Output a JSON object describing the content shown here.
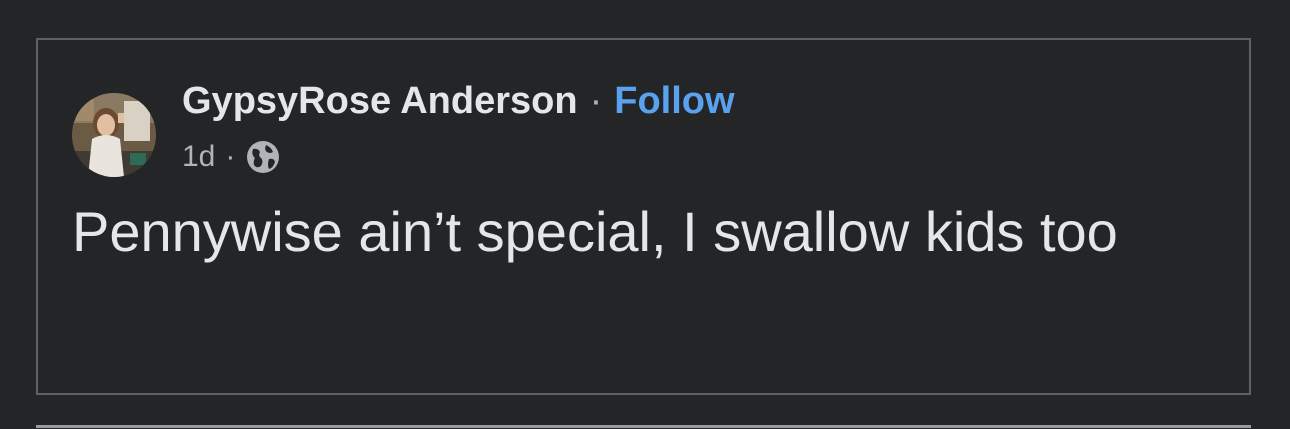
{
  "post": {
    "author_name": "GypsyRose Anderson",
    "separator": "·",
    "follow_label": "Follow",
    "timestamp": "1d",
    "meta_separator": "·",
    "privacy_icon": "globe-icon",
    "text": "Pennywise ain’t special, I swallow kids too"
  },
  "colors": {
    "background": "#242527",
    "text_primary": "#e4e6eb",
    "text_secondary": "#b0b3b8",
    "accent": "#5aa1f0"
  }
}
